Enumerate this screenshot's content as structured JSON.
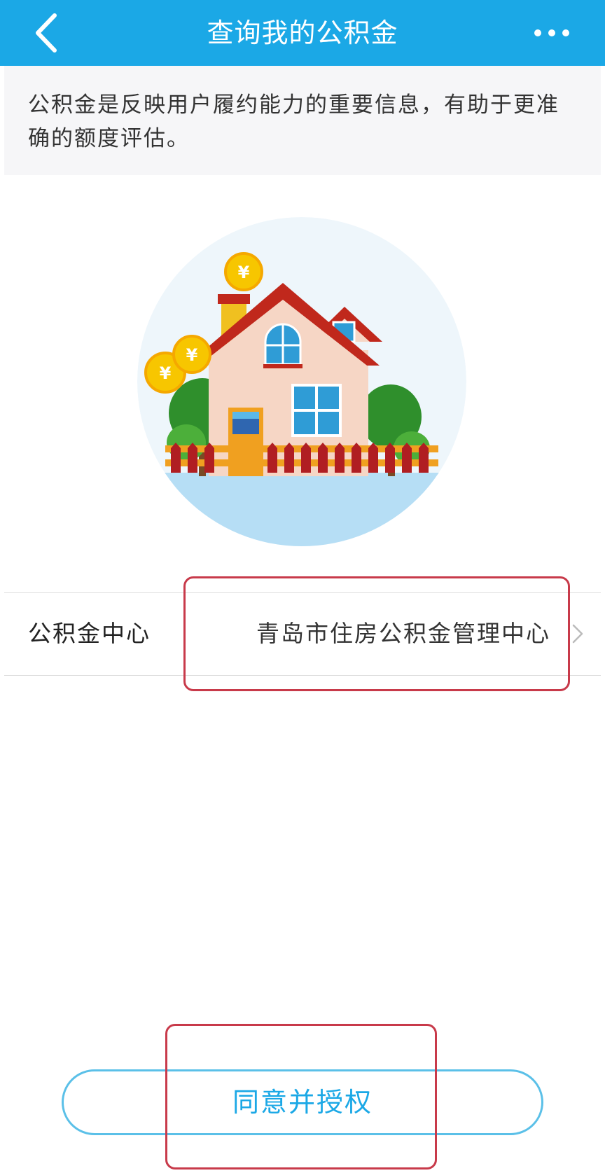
{
  "nav": {
    "title": "查询我的公积金",
    "back_icon": "chevron-left-icon",
    "more_icon": "more-dots-icon",
    "color": "#1ba8e6"
  },
  "notice": {
    "text": "公积金是反映用户履约能力的重要信息，有助于更准确的额度评估。"
  },
  "illustration": {
    "icon": "house-coins-illustration",
    "coin_glyph": "¥"
  },
  "fund_center_row": {
    "label": "公积金中心",
    "value": "青岛市住房公积金管理中心",
    "icon": "chevron-right-icon"
  },
  "actions": {
    "agree_label": "同意并授权"
  },
  "annotation": {
    "color": "#c83a4a"
  }
}
